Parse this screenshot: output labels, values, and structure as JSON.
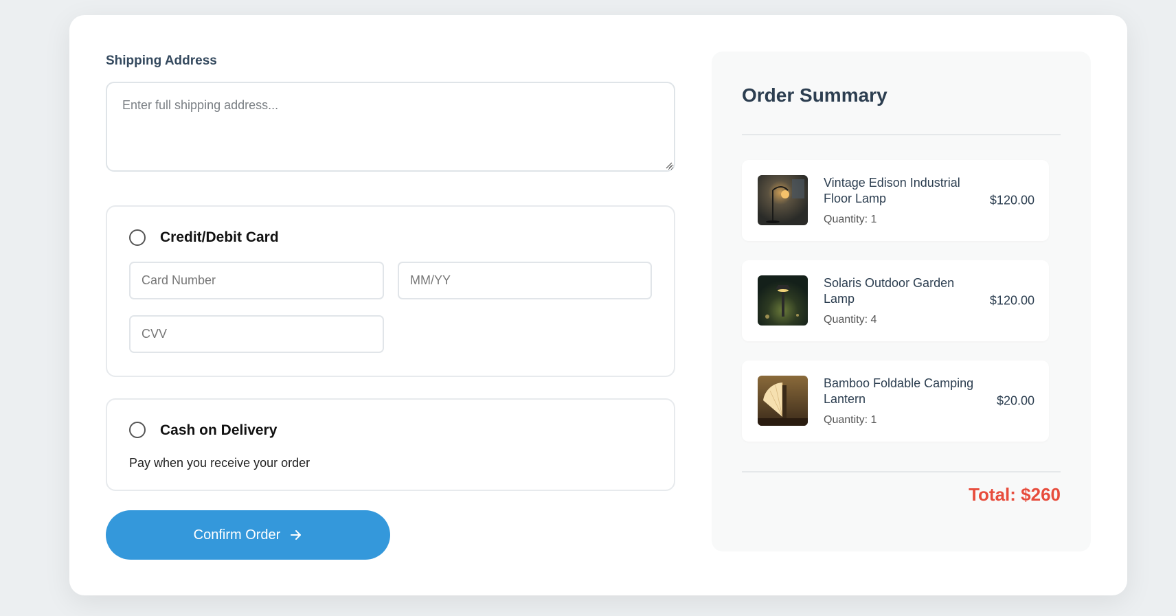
{
  "shipping": {
    "label": "Shipping Address",
    "placeholder": "Enter full shipping address..."
  },
  "payment": {
    "card": {
      "title": "Credit/Debit Card",
      "card_number_placeholder": "Card Number",
      "expiry_placeholder": "MM/YY",
      "cvv_placeholder": "CVV"
    },
    "cod": {
      "title": "Cash on Delivery",
      "description": "Pay when you receive your order"
    }
  },
  "confirm_button": {
    "label": "Confirm Order",
    "icon": "arrow-right-icon"
  },
  "summary": {
    "title": "Order Summary",
    "items": [
      {
        "name": "Vintage Edison Industrial Floor Lamp",
        "quantity": "Quantity: 1",
        "price": "$120.00",
        "icon": "floor-lamp-image"
      },
      {
        "name": "Solaris Outdoor Garden Lamp",
        "quantity": "Quantity: 4",
        "price": "$120.00",
        "icon": "garden-lamp-image"
      },
      {
        "name": "Bamboo Foldable Camping Lantern",
        "quantity": "Quantity: 1",
        "price": "$20.00",
        "icon": "camping-lantern-image"
      }
    ],
    "total": "Total: $260"
  },
  "colors": {
    "accent": "#3498db",
    "total": "#e74c3c",
    "heading": "#2c3e50"
  }
}
